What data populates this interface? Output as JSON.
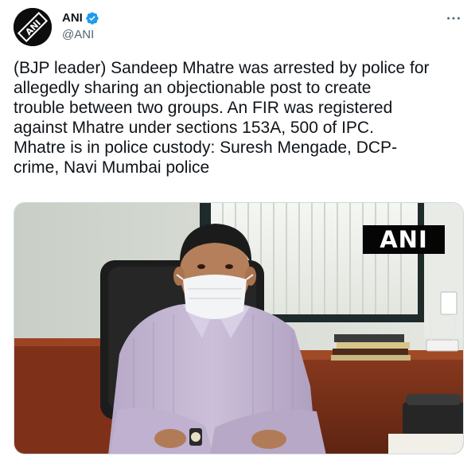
{
  "account": {
    "display_name": "ANI",
    "handle": "@ANI",
    "verified": true,
    "avatar_logo_text": "ANI"
  },
  "tweet": {
    "text": "(BJP leader) Sandeep Mhatre was arrested by police for\nallegedly sharing an objectionable post to create\ntrouble between two groups. An FIR was registered\nagainst Mhatre under sections 153A, 500 of IPC.\nMhatre is in police custody: Suresh Mengade, DCP-\ncrime, Navi Mumbai police"
  },
  "media": {
    "watermark": "ANI"
  },
  "icons": {
    "more": "more-horizontal-icon",
    "verified": "verified-badge-icon"
  },
  "colors": {
    "accent": "#1d9bf0",
    "secondary_text": "#536471",
    "border": "#cfd9de"
  }
}
